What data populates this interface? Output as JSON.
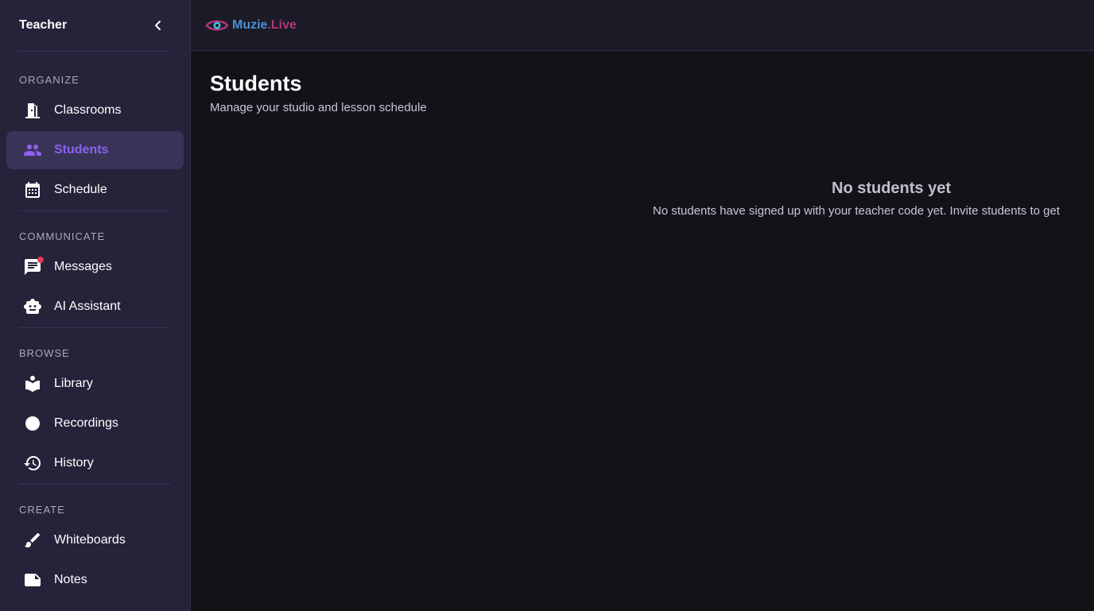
{
  "sidebar": {
    "title": "Teacher",
    "sections": [
      {
        "label": "ORGANIZE",
        "items": [
          {
            "label": "Classrooms",
            "icon": "door-icon"
          },
          {
            "label": "Students",
            "icon": "people-icon",
            "active": true
          },
          {
            "label": "Schedule",
            "icon": "calendar-icon"
          }
        ]
      },
      {
        "label": "COMMUNICATE",
        "items": [
          {
            "label": "Messages",
            "icon": "chat-icon",
            "badge": true
          },
          {
            "label": "AI Assistant",
            "icon": "robot-icon"
          }
        ]
      },
      {
        "label": "BROWSE",
        "items": [
          {
            "label": "Library",
            "icon": "book-icon"
          },
          {
            "label": "Recordings",
            "icon": "record-dot-icon"
          },
          {
            "label": "History",
            "icon": "history-icon"
          }
        ]
      },
      {
        "label": "CREATE",
        "items": [
          {
            "label": "Whiteboards",
            "icon": "brush-icon"
          },
          {
            "label": "Notes",
            "icon": "note-icon"
          }
        ]
      }
    ]
  },
  "topbar": {
    "logo_main": "Muzie",
    "logo_suffix": ".Live"
  },
  "page": {
    "title": "Students",
    "subtitle": "Manage your studio and lesson schedule"
  },
  "empty_state": {
    "title": "No students yet",
    "description": "No students have signed up with your teacher code yet. Invite students to get"
  },
  "colors": {
    "accent": "#8b63ee",
    "sidebar_bg": "#25223a",
    "main_bg": "#141219",
    "badge": "#e53950"
  }
}
